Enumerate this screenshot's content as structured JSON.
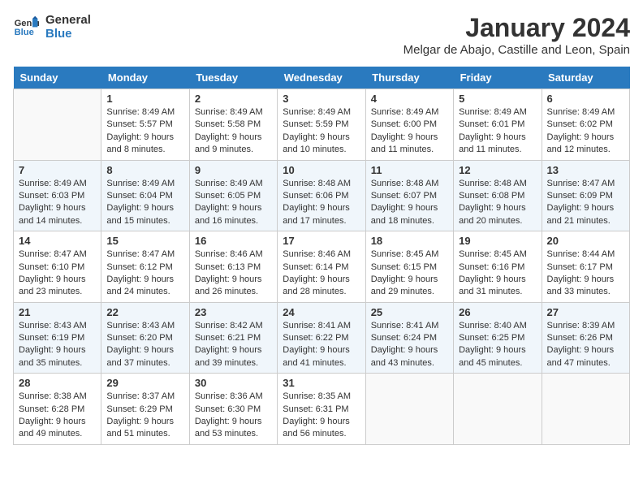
{
  "header": {
    "logo_line1": "General",
    "logo_line2": "Blue",
    "month_title": "January 2024",
    "location": "Melgar de Abajo, Castille and Leon, Spain"
  },
  "days_of_week": [
    "Sunday",
    "Monday",
    "Tuesday",
    "Wednesday",
    "Thursday",
    "Friday",
    "Saturday"
  ],
  "weeks": [
    [
      {
        "day": "",
        "sunrise": "",
        "sunset": "",
        "daylight": ""
      },
      {
        "day": "1",
        "sunrise": "Sunrise: 8:49 AM",
        "sunset": "Sunset: 5:57 PM",
        "daylight": "Daylight: 9 hours and 8 minutes."
      },
      {
        "day": "2",
        "sunrise": "Sunrise: 8:49 AM",
        "sunset": "Sunset: 5:58 PM",
        "daylight": "Daylight: 9 hours and 9 minutes."
      },
      {
        "day": "3",
        "sunrise": "Sunrise: 8:49 AM",
        "sunset": "Sunset: 5:59 PM",
        "daylight": "Daylight: 9 hours and 10 minutes."
      },
      {
        "day": "4",
        "sunrise": "Sunrise: 8:49 AM",
        "sunset": "Sunset: 6:00 PM",
        "daylight": "Daylight: 9 hours and 11 minutes."
      },
      {
        "day": "5",
        "sunrise": "Sunrise: 8:49 AM",
        "sunset": "Sunset: 6:01 PM",
        "daylight": "Daylight: 9 hours and 11 minutes."
      },
      {
        "day": "6",
        "sunrise": "Sunrise: 8:49 AM",
        "sunset": "Sunset: 6:02 PM",
        "daylight": "Daylight: 9 hours and 12 minutes."
      }
    ],
    [
      {
        "day": "7",
        "sunrise": "Sunrise: 8:49 AM",
        "sunset": "Sunset: 6:03 PM",
        "daylight": "Daylight: 9 hours and 14 minutes."
      },
      {
        "day": "8",
        "sunrise": "Sunrise: 8:49 AM",
        "sunset": "Sunset: 6:04 PM",
        "daylight": "Daylight: 9 hours and 15 minutes."
      },
      {
        "day": "9",
        "sunrise": "Sunrise: 8:49 AM",
        "sunset": "Sunset: 6:05 PM",
        "daylight": "Daylight: 9 hours and 16 minutes."
      },
      {
        "day": "10",
        "sunrise": "Sunrise: 8:48 AM",
        "sunset": "Sunset: 6:06 PM",
        "daylight": "Daylight: 9 hours and 17 minutes."
      },
      {
        "day": "11",
        "sunrise": "Sunrise: 8:48 AM",
        "sunset": "Sunset: 6:07 PM",
        "daylight": "Daylight: 9 hours and 18 minutes."
      },
      {
        "day": "12",
        "sunrise": "Sunrise: 8:48 AM",
        "sunset": "Sunset: 6:08 PM",
        "daylight": "Daylight: 9 hours and 20 minutes."
      },
      {
        "day": "13",
        "sunrise": "Sunrise: 8:47 AM",
        "sunset": "Sunset: 6:09 PM",
        "daylight": "Daylight: 9 hours and 21 minutes."
      }
    ],
    [
      {
        "day": "14",
        "sunrise": "Sunrise: 8:47 AM",
        "sunset": "Sunset: 6:10 PM",
        "daylight": "Daylight: 9 hours and 23 minutes."
      },
      {
        "day": "15",
        "sunrise": "Sunrise: 8:47 AM",
        "sunset": "Sunset: 6:12 PM",
        "daylight": "Daylight: 9 hours and 24 minutes."
      },
      {
        "day": "16",
        "sunrise": "Sunrise: 8:46 AM",
        "sunset": "Sunset: 6:13 PM",
        "daylight": "Daylight: 9 hours and 26 minutes."
      },
      {
        "day": "17",
        "sunrise": "Sunrise: 8:46 AM",
        "sunset": "Sunset: 6:14 PM",
        "daylight": "Daylight: 9 hours and 28 minutes."
      },
      {
        "day": "18",
        "sunrise": "Sunrise: 8:45 AM",
        "sunset": "Sunset: 6:15 PM",
        "daylight": "Daylight: 9 hours and 29 minutes."
      },
      {
        "day": "19",
        "sunrise": "Sunrise: 8:45 AM",
        "sunset": "Sunset: 6:16 PM",
        "daylight": "Daylight: 9 hours and 31 minutes."
      },
      {
        "day": "20",
        "sunrise": "Sunrise: 8:44 AM",
        "sunset": "Sunset: 6:17 PM",
        "daylight": "Daylight: 9 hours and 33 minutes."
      }
    ],
    [
      {
        "day": "21",
        "sunrise": "Sunrise: 8:43 AM",
        "sunset": "Sunset: 6:19 PM",
        "daylight": "Daylight: 9 hours and 35 minutes."
      },
      {
        "day": "22",
        "sunrise": "Sunrise: 8:43 AM",
        "sunset": "Sunset: 6:20 PM",
        "daylight": "Daylight: 9 hours and 37 minutes."
      },
      {
        "day": "23",
        "sunrise": "Sunrise: 8:42 AM",
        "sunset": "Sunset: 6:21 PM",
        "daylight": "Daylight: 9 hours and 39 minutes."
      },
      {
        "day": "24",
        "sunrise": "Sunrise: 8:41 AM",
        "sunset": "Sunset: 6:22 PM",
        "daylight": "Daylight: 9 hours and 41 minutes."
      },
      {
        "day": "25",
        "sunrise": "Sunrise: 8:41 AM",
        "sunset": "Sunset: 6:24 PM",
        "daylight": "Daylight: 9 hours and 43 minutes."
      },
      {
        "day": "26",
        "sunrise": "Sunrise: 8:40 AM",
        "sunset": "Sunset: 6:25 PM",
        "daylight": "Daylight: 9 hours and 45 minutes."
      },
      {
        "day": "27",
        "sunrise": "Sunrise: 8:39 AM",
        "sunset": "Sunset: 6:26 PM",
        "daylight": "Daylight: 9 hours and 47 minutes."
      }
    ],
    [
      {
        "day": "28",
        "sunrise": "Sunrise: 8:38 AM",
        "sunset": "Sunset: 6:28 PM",
        "daylight": "Daylight: 9 hours and 49 minutes."
      },
      {
        "day": "29",
        "sunrise": "Sunrise: 8:37 AM",
        "sunset": "Sunset: 6:29 PM",
        "daylight": "Daylight: 9 hours and 51 minutes."
      },
      {
        "day": "30",
        "sunrise": "Sunrise: 8:36 AM",
        "sunset": "Sunset: 6:30 PM",
        "daylight": "Daylight: 9 hours and 53 minutes."
      },
      {
        "day": "31",
        "sunrise": "Sunrise: 8:35 AM",
        "sunset": "Sunset: 6:31 PM",
        "daylight": "Daylight: 9 hours and 56 minutes."
      },
      {
        "day": "",
        "sunrise": "",
        "sunset": "",
        "daylight": ""
      },
      {
        "day": "",
        "sunrise": "",
        "sunset": "",
        "daylight": ""
      },
      {
        "day": "",
        "sunrise": "",
        "sunset": "",
        "daylight": ""
      }
    ]
  ]
}
